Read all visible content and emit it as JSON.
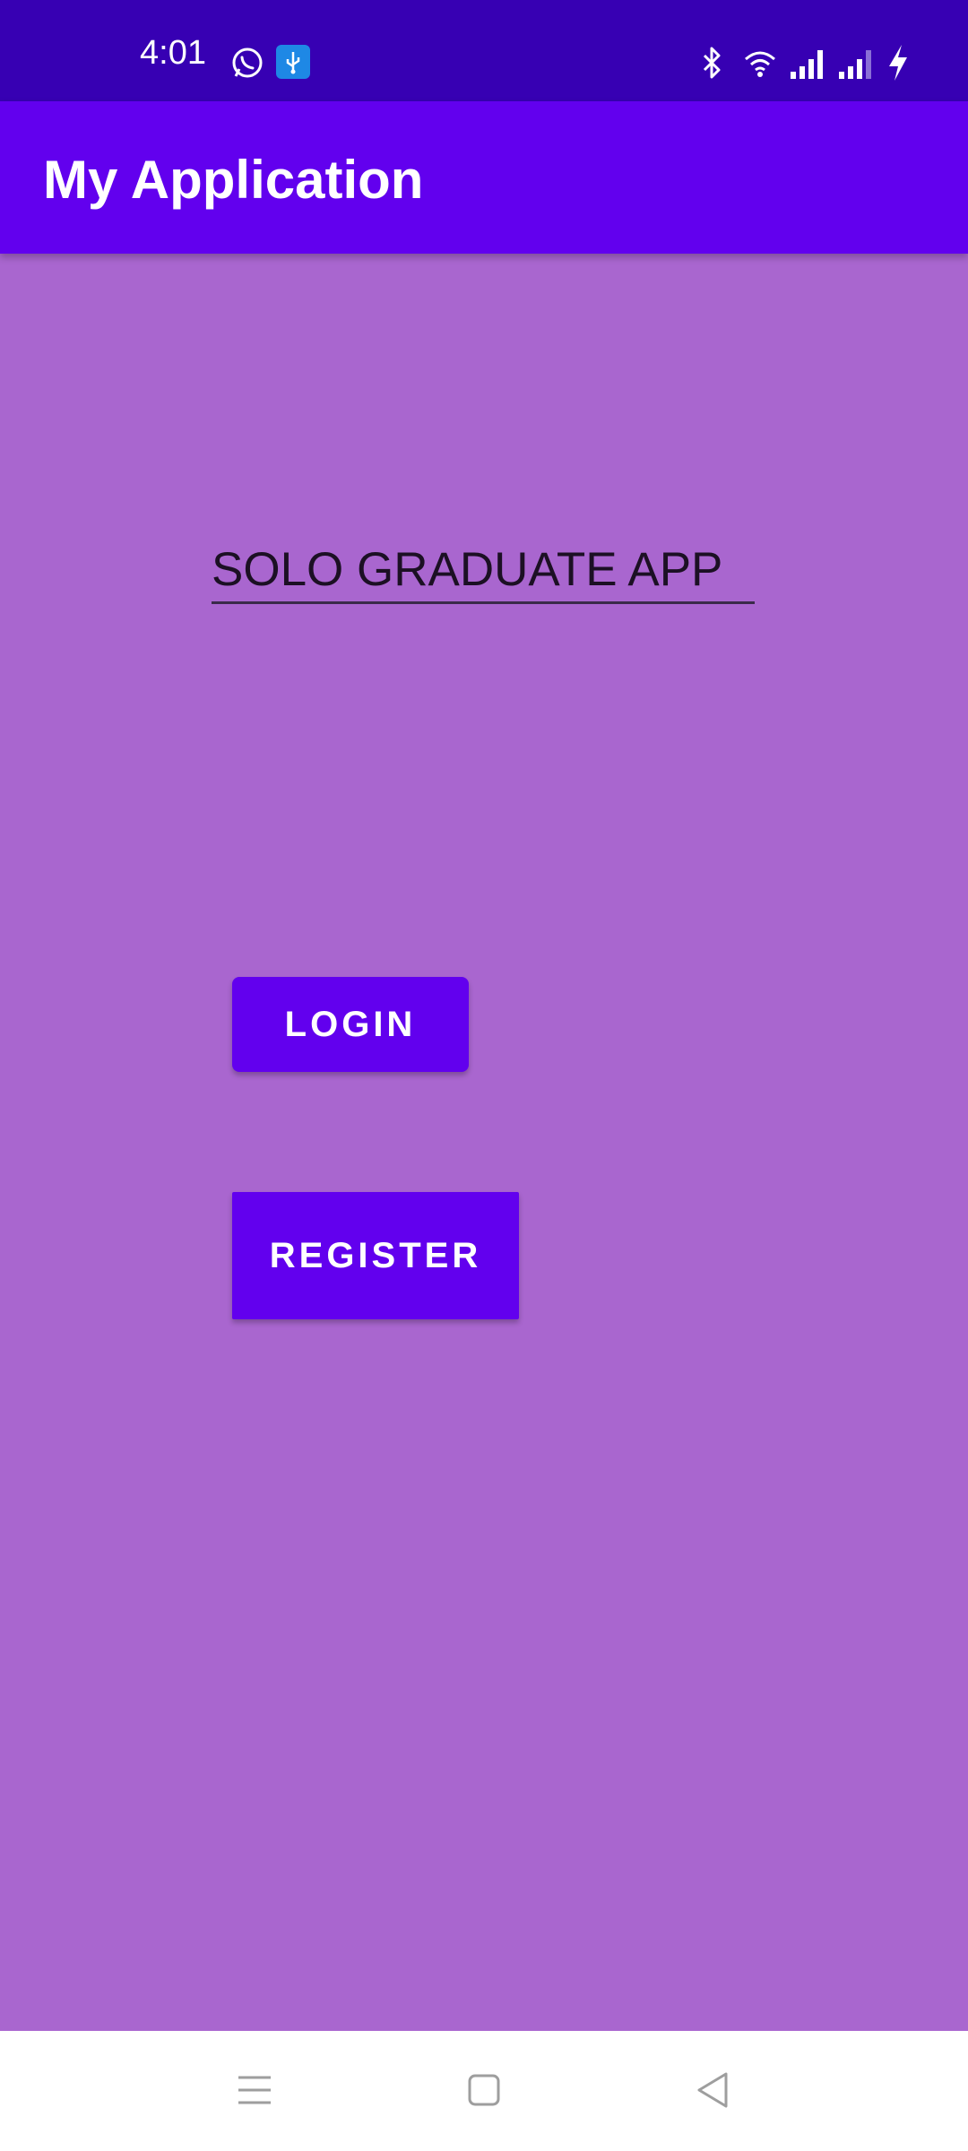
{
  "status_bar": {
    "time": "4:01",
    "icons": [
      "whatsapp-icon",
      "usb-debug-icon",
      "bluetooth-icon",
      "wifi-icon",
      "signal-icon",
      "signal-icon",
      "charging-icon"
    ]
  },
  "app_bar": {
    "title": "My Application"
  },
  "main": {
    "title_field_value": "SOLO GRADUATE APP",
    "login_label": "LOGIN",
    "register_label": "REGISTER"
  },
  "nav_bar": {
    "icons": [
      "menu-icon",
      "home-icon",
      "back-icon"
    ]
  },
  "colors": {
    "status_bar": "#3700B3",
    "app_bar": "#6200EE",
    "background": "#A966CF",
    "button": "#6200EE",
    "nav_bar": "#FFFFFF"
  }
}
